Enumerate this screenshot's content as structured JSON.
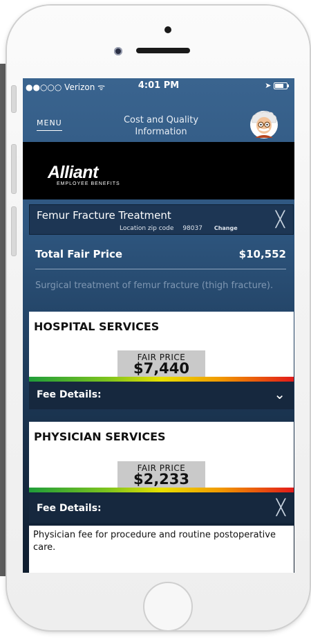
{
  "status_bar": {
    "carrier": "●●○○○ Verizon ᯤ",
    "time": "4:01 PM",
    "location_icon": "location-arrow-icon",
    "battery_icon": "battery-icon"
  },
  "nav": {
    "menu_label": "MENU",
    "title": "Cost and Quality Information",
    "avatar_icon": "professor-avatar-icon"
  },
  "banner": {
    "brand": "Alliant",
    "tagline": "EMPLOYEE BENEFITS"
  },
  "search": {
    "title": "Femur Fracture Treatment",
    "zip_label": "Location zip code",
    "zip_value": "98037",
    "change_label": "Change",
    "close_symbol": "╳"
  },
  "summary": {
    "total_label": "Total Fair Price",
    "total_value": "$10,552",
    "description": "Surgical treatment of femur fracture (thigh fracture)."
  },
  "services": [
    {
      "title": "HOSPITAL SERVICES",
      "price_label": "FAIR PRICE",
      "price_value": "$7,440",
      "fee_label": "Fee Details:",
      "fee_toggle": "⌄"
    },
    {
      "title": "PHYSICIAN SERVICES",
      "price_label": "FAIR PRICE",
      "price_value": "$2,233",
      "fee_label": "Fee Details:",
      "fee_toggle": "╳",
      "fee_text": "Physician fee for procedure and routine postoperative care."
    }
  ],
  "colors": {
    "screen_top": "#3a648f",
    "screen_bottom": "#0f1d2e",
    "banner": "#000000",
    "fee_bar": "#16283e"
  }
}
